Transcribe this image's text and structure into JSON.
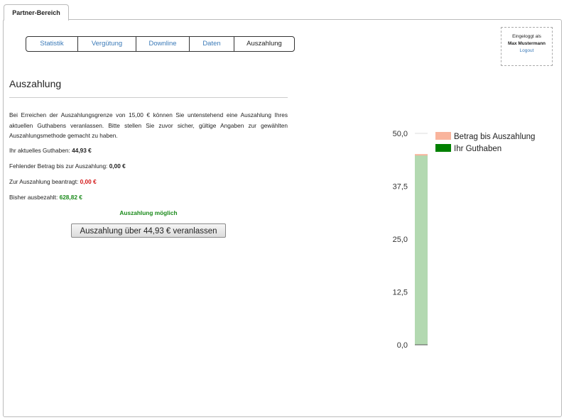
{
  "tab": {
    "label": "Partner-Bereich"
  },
  "nav": {
    "items": [
      {
        "label": "Statistik"
      },
      {
        "label": "Vergütung"
      },
      {
        "label": "Downline"
      },
      {
        "label": "Daten"
      },
      {
        "label": "Auszahlung"
      }
    ]
  },
  "login": {
    "status": "Eingeloggt als",
    "user": "Max Mustermann",
    "logout": "Logout"
  },
  "page": {
    "heading": "Auszahlung",
    "description": "Bei Erreichen der Auszahlungsgrenze von 15,00 € können Sie untenstehend eine Auszahlung Ihres aktuellen Guthabens veranlassen. Bitte stellen Sie zuvor sicher, gültige Angaben zur gewählten Auszahlungsmethode gemacht zu haben.",
    "balance_label": "Ihr aktuelles Guthaben:",
    "balance_value": "44,93 €",
    "missing_label": "Fehlender Betrag bis zur Auszahlung:",
    "missing_value": "0,00 €",
    "requested_label": "Zur Auszahlung beantragt:",
    "requested_value": "0,00 €",
    "paid_label": "Bisher ausbezahlt:",
    "paid_value": "628,82 €",
    "possible": "Auszahlung möglich",
    "button": "Auszahlung über 44,93 € veranlassen"
  },
  "colors": {
    "link": "#3b7ab8",
    "red": "#d31818",
    "green": "#1a8a1a"
  },
  "chart_data": {
    "type": "bar",
    "stacked": true,
    "categories": [
      ""
    ],
    "series": [
      {
        "name": "Ihr Guthaben",
        "values": [
          44.93
        ],
        "color": "#b3d9b1",
        "legend_color": "#008000"
      },
      {
        "name": "Betrag bis Auszahlung",
        "values": [
          0.0
        ],
        "color": "#f9b49c",
        "legend_color": "#f9b49c"
      }
    ],
    "ylim": [
      0,
      50
    ],
    "yticks": [
      "0,0",
      "12,5",
      "25,0",
      "37,5",
      "50,0"
    ],
    "ytick_values": [
      0,
      12.5,
      25,
      37.5,
      50
    ],
    "legend": "top-right",
    "grid": false
  }
}
